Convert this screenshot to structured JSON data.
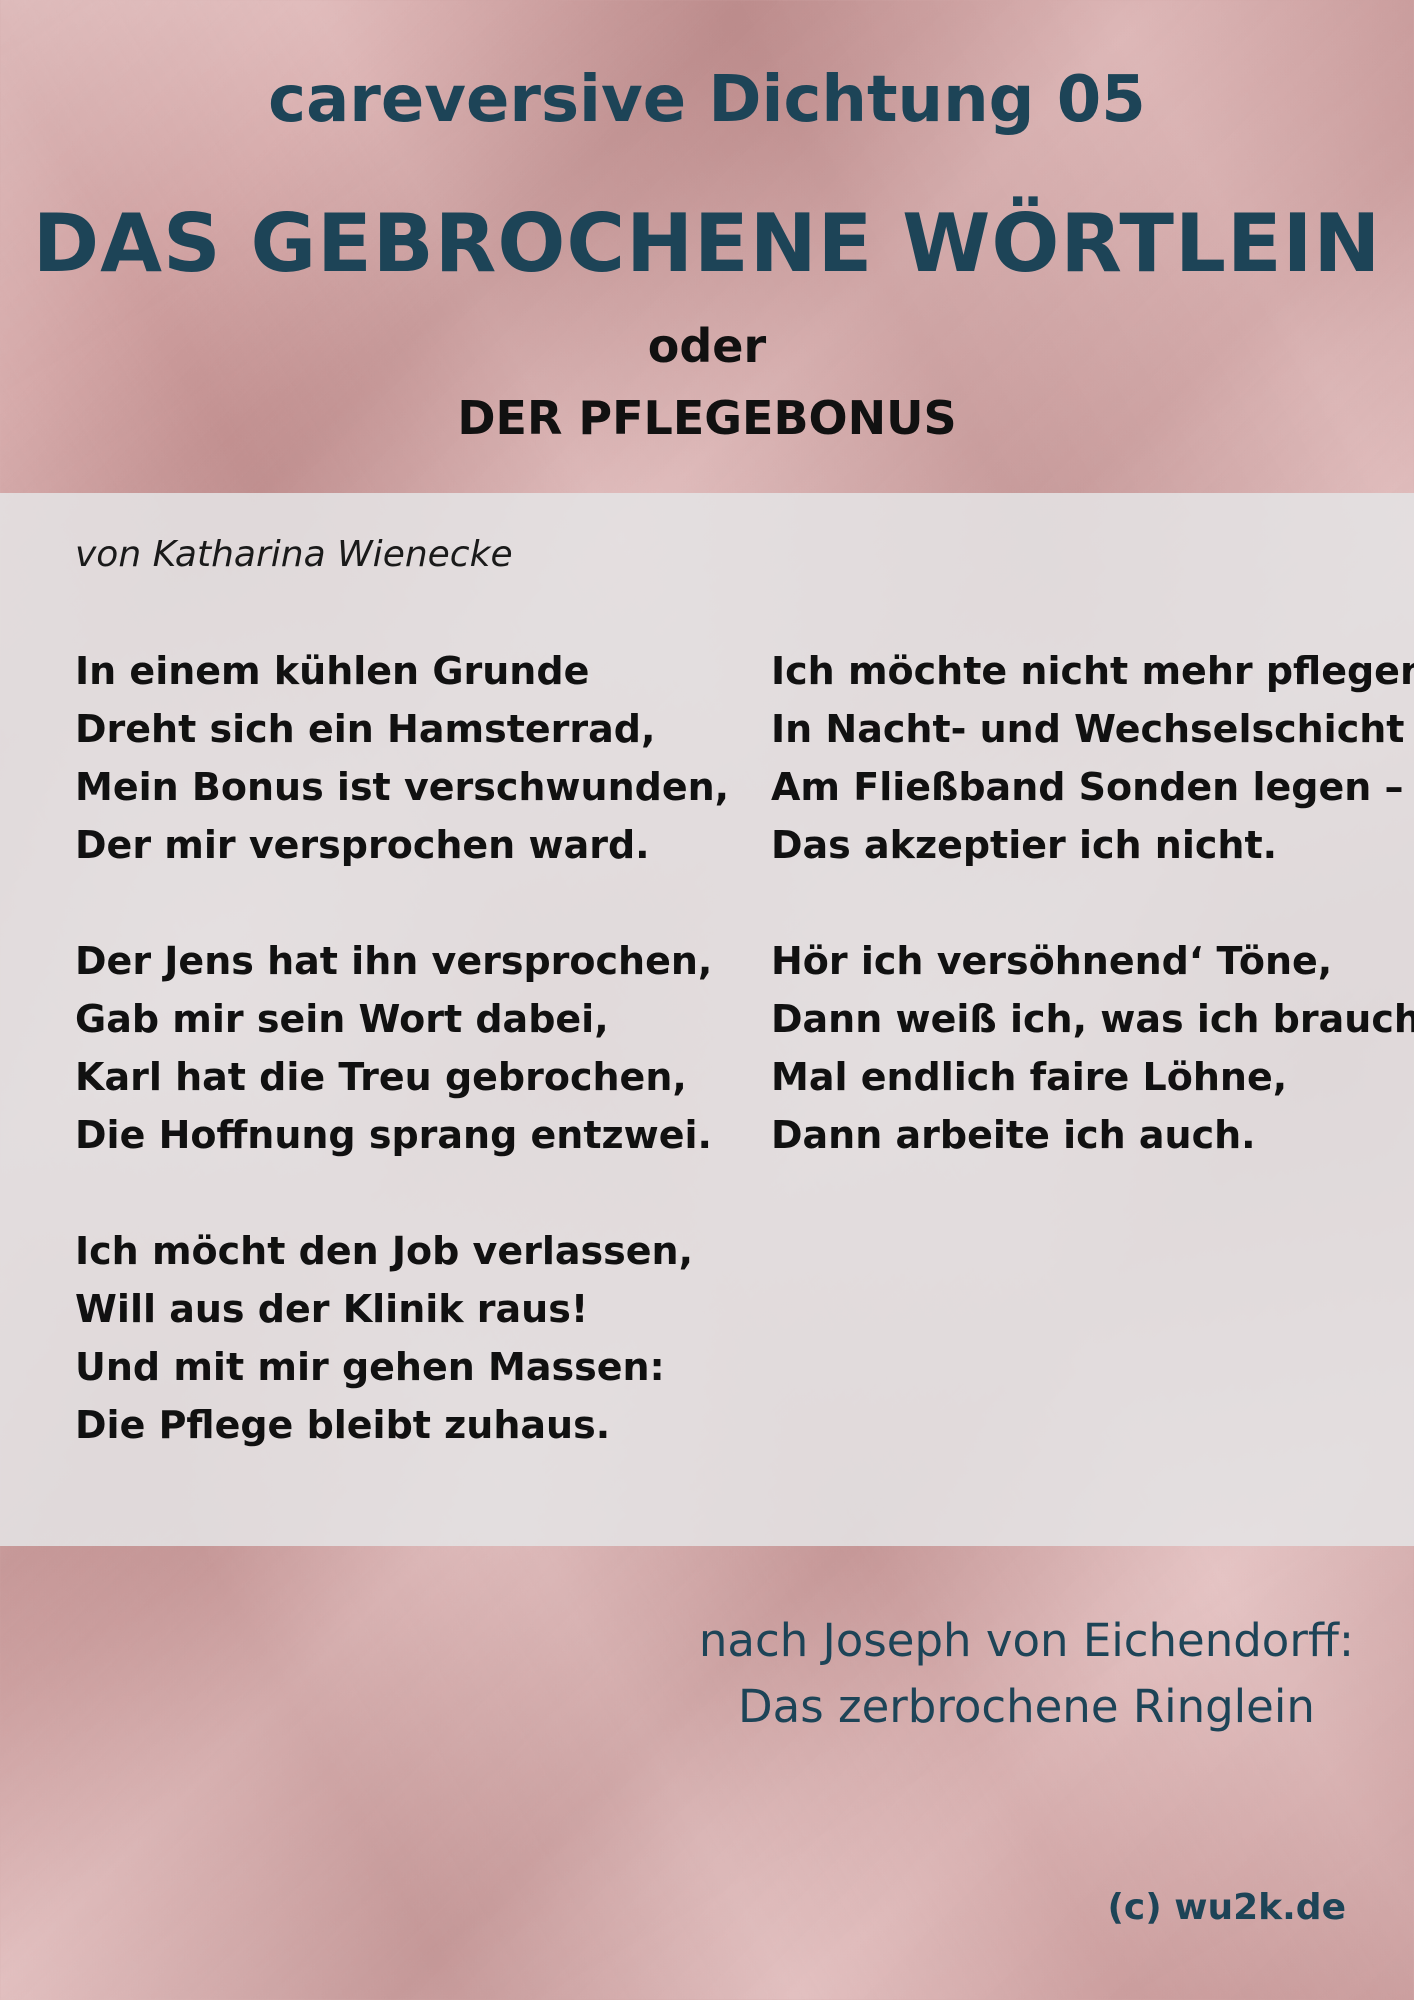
{
  "header": {
    "series_title": "careversive Dichtung 05",
    "main_title": "DAS GEBROCHENE WÖRTLEIN",
    "connector": "oder",
    "subtitle": "DER PFLEGEBONUS"
  },
  "poem": {
    "author": "von Katharina Wienecke",
    "left_column": [
      {
        "lines": [
          "In einem kühlen Grunde",
          "Dreht sich ein Hamsterrad,",
          "Mein Bonus ist verschwunden,",
          "Der mir versprochen ward."
        ]
      },
      {
        "lines": [
          "Der Jens hat ihn versprochen,",
          "Gab mir sein Wort dabei,",
          "Karl hat die Treu gebrochen,",
          "Die Hoffnung sprang entzwei."
        ]
      },
      {
        "lines": [
          "Ich möcht den Job verlassen,",
          "Will aus der Klinik raus!",
          "Und mit mir gehen Massen:",
          "Die Pflege bleibt zuhaus."
        ]
      }
    ],
    "right_column": [
      {
        "lines": [
          "Ich möchte nicht mehr pflegen!",
          "In Nacht- und Wechselschicht",
          "Am Fließband Sonden legen –",
          "Das akzeptier ich nicht."
        ]
      },
      {
        "lines": [
          "Hör ich versöhnend‘ Töne,",
          "Dann weiß ich, was ich brauch‘",
          "Mal endlich faire Löhne,",
          "Dann arbeite ich auch."
        ]
      }
    ]
  },
  "footer": {
    "source_line_1": "nach Joseph von Eichendorff:",
    "source_line_2": "Das zerbrochene Ringlein",
    "copyright": "(c) wu2k.de"
  },
  "colors": {
    "title_blue": "#1d4457",
    "background_pink": "#d9a9a9",
    "panel_grey": "#e4e2e4",
    "text_dark": "#111111"
  }
}
